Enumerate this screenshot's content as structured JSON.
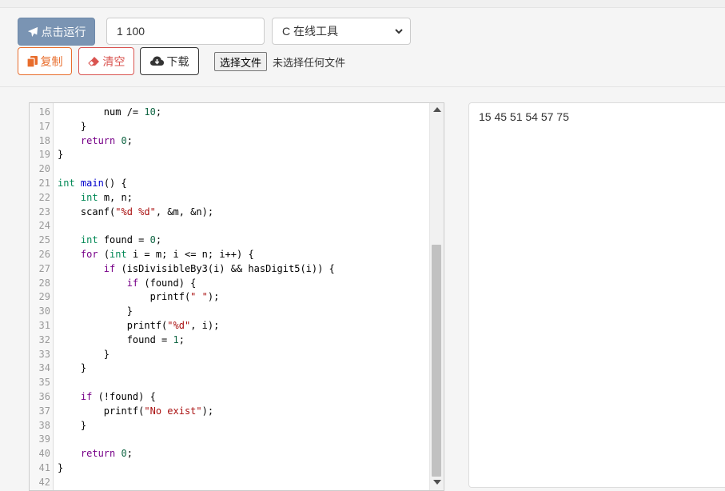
{
  "toolbar": {
    "run_label": "点击运行",
    "input_value": "1 100",
    "language_select": "C 在线工具",
    "copy_label": "复制",
    "clear_label": "清空",
    "download_label": "下载",
    "choose_file_label": "选择文件",
    "no_file_label": "未选择任何文件"
  },
  "editor": {
    "lines": [
      {
        "n": "16",
        "code": "        num /= 10;"
      },
      {
        "n": "17",
        "code": "    }"
      },
      {
        "n": "18",
        "code": "    return 0;"
      },
      {
        "n": "19",
        "code": "}"
      },
      {
        "n": "20",
        "code": ""
      },
      {
        "n": "21",
        "code": "int main() {"
      },
      {
        "n": "22",
        "code": "    int m, n;"
      },
      {
        "n": "23",
        "code": "    scanf(\"%d %d\", &m, &n);"
      },
      {
        "n": "24",
        "code": ""
      },
      {
        "n": "25",
        "code": "    int found = 0;"
      },
      {
        "n": "26",
        "code": "    for (int i = m; i <= n; i++) {"
      },
      {
        "n": "27",
        "code": "        if (isDivisibleBy3(i) && hasDigit5(i)) {"
      },
      {
        "n": "28",
        "code": "            if (found) {"
      },
      {
        "n": "29",
        "code": "                printf(\" \");"
      },
      {
        "n": "30",
        "code": "            }"
      },
      {
        "n": "31",
        "code": "            printf(\"%d\", i);"
      },
      {
        "n": "32",
        "code": "            found = 1;"
      },
      {
        "n": "33",
        "code": "        }"
      },
      {
        "n": "34",
        "code": "    }"
      },
      {
        "n": "35",
        "code": ""
      },
      {
        "n": "36",
        "code": "    if (!found) {"
      },
      {
        "n": "37",
        "code": "        printf(\"No exist\");"
      },
      {
        "n": "38",
        "code": "    }"
      },
      {
        "n": "39",
        "code": ""
      },
      {
        "n": "40",
        "code": "    return 0;"
      },
      {
        "n": "41",
        "code": "}"
      },
      {
        "n": "42",
        "code": ""
      }
    ]
  },
  "output": {
    "text": "15 45 51 54 57 75"
  },
  "icons": {
    "run": "paper-plane-icon",
    "copy": "copy-icon",
    "clear": "eraser-icon",
    "download": "cloud-download-icon",
    "select": "chevron-down-icon"
  },
  "colors": {
    "run_button": "#7a94b3",
    "copy_button": "#e86d2c",
    "clear_button": "#d9534f",
    "keyword": "#770088",
    "type": "#008855",
    "number": "#116644",
    "string": "#aa1111"
  }
}
